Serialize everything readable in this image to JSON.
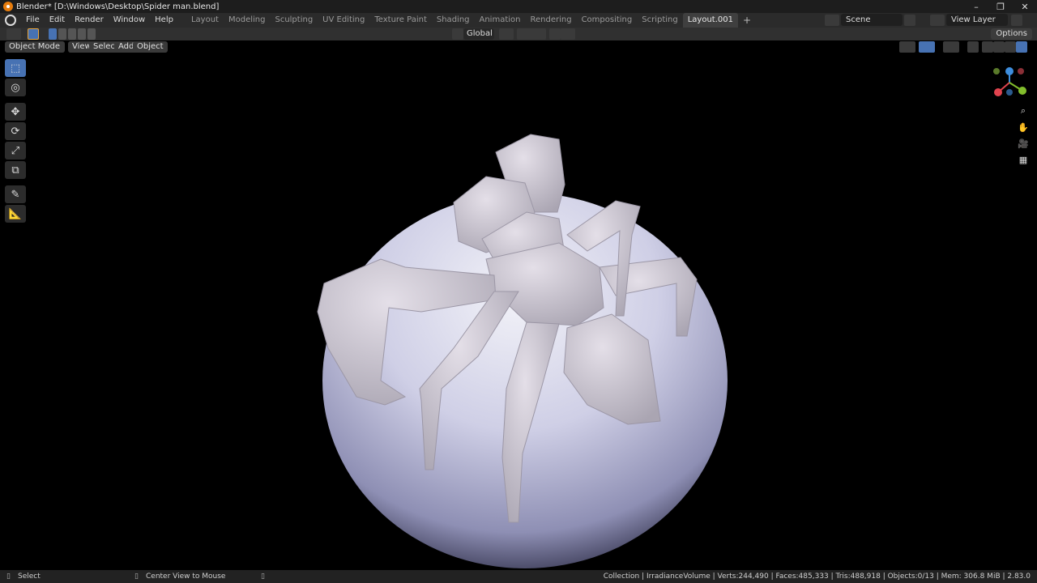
{
  "window": {
    "title": "Blender* [D:\\Windows\\Desktop\\Spider man.blend]",
    "minimize": "–",
    "maximize": "❐",
    "close": "✕"
  },
  "menu": {
    "items": [
      "File",
      "Edit",
      "Render",
      "Window",
      "Help"
    ]
  },
  "workspaces": {
    "tabs": [
      "Layout",
      "Modeling",
      "Sculpting",
      "UV Editing",
      "Texture Paint",
      "Shading",
      "Animation",
      "Rendering",
      "Compositing",
      "Scripting",
      "Layout.001"
    ],
    "active": "Layout.001",
    "add": "+"
  },
  "scene": {
    "name": "Scene"
  },
  "view_layer": {
    "name": "View Layer"
  },
  "tool_header": {
    "orientation": "Global",
    "options": "Options"
  },
  "viewport_header": {
    "mode": "Object Mode",
    "view": "View",
    "select": "Select",
    "add": "Add",
    "object": "Object"
  },
  "toolbar": {
    "tools": [
      {
        "icon": "select-box-icon",
        "glyph": "⬚"
      },
      {
        "icon": "cursor-icon",
        "glyph": "◎"
      },
      {
        "icon": "move-icon",
        "glyph": "✥"
      },
      {
        "icon": "rotate-icon",
        "glyph": "⟳"
      },
      {
        "icon": "scale-icon",
        "glyph": "⤢"
      },
      {
        "icon": "transform-icon",
        "glyph": "⧉"
      },
      {
        "icon": "annotate-icon",
        "glyph": "✎"
      },
      {
        "icon": "measure-icon",
        "glyph": "📐"
      }
    ]
  },
  "nav": {
    "zoom": "⌕",
    "pan": "✋",
    "camera": "🎥",
    "ortho": "▦"
  },
  "status": {
    "select": "Select",
    "center_view": "Center View to Mouse",
    "stats": "Collection | IrradianceVolume | Verts:244,490 | Faces:485,333 | Tris:488,918 | Objects:0/13 | Mem: 306.8 MiB | 2.83.0"
  },
  "colors": {
    "accent": "#4772b3",
    "x_axis": "#e0434e",
    "y_axis": "#82be2c",
    "z_axis": "#3e8ede"
  }
}
